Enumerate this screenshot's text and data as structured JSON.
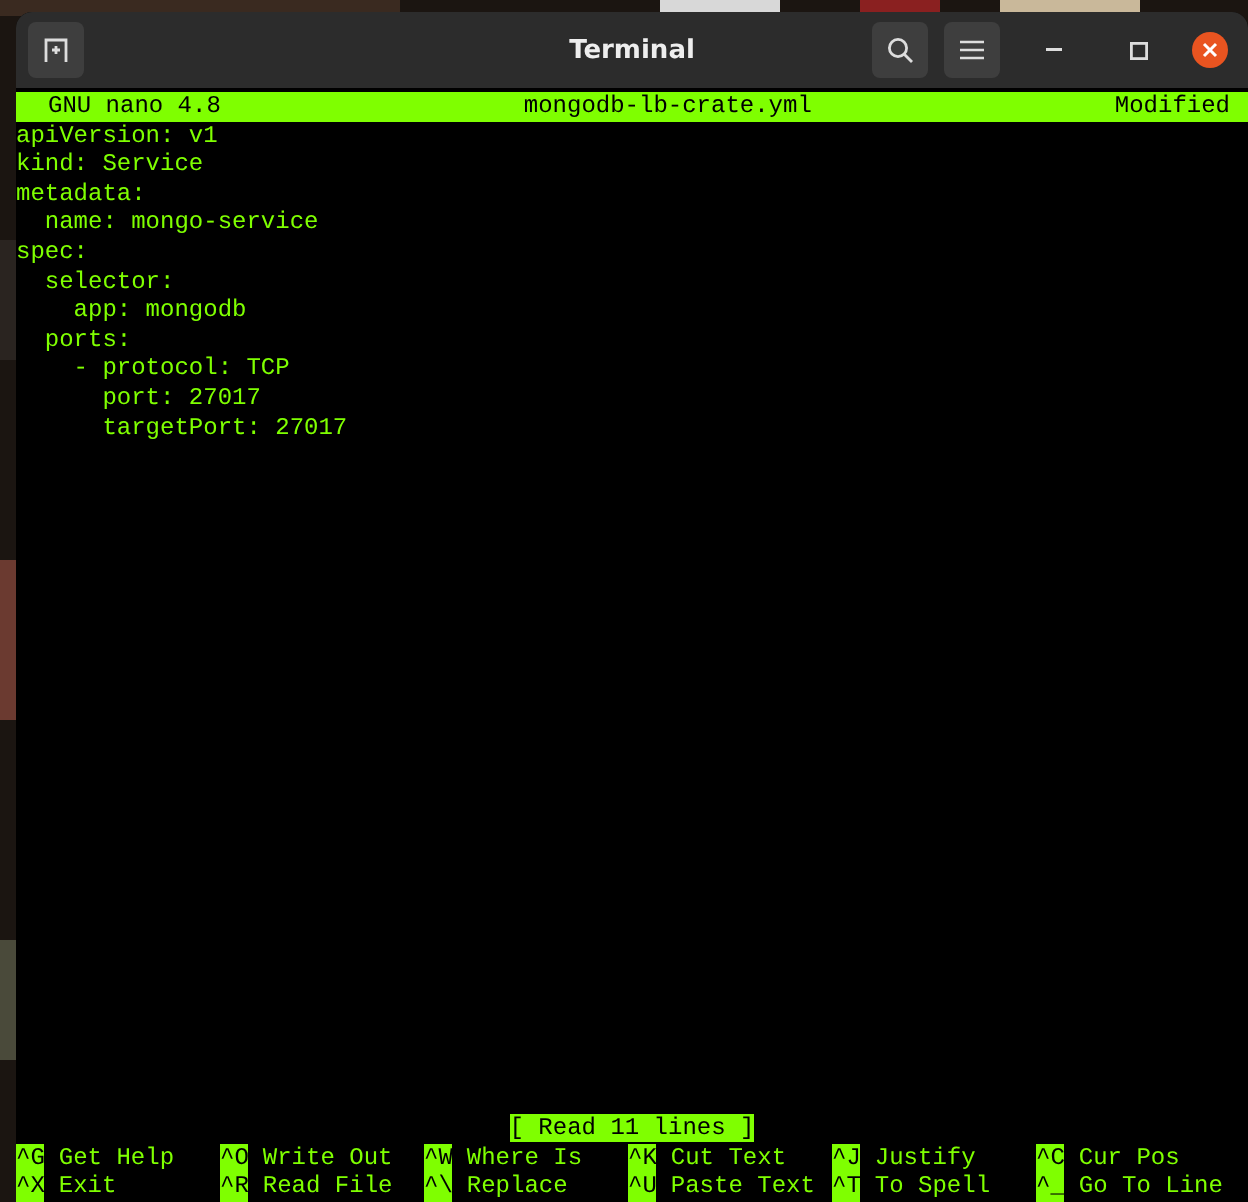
{
  "window": {
    "title": "Terminal"
  },
  "nano": {
    "header": {
      "version": "GNU nano 4.8",
      "filename": "mongodb-lb-crate.yml",
      "state": "Modified"
    },
    "lines": [
      "apiVersion: v1",
      "kind: Service",
      "metadata:",
      "  name: mongo-service",
      "spec:",
      "  selector:",
      "    app: mongodb",
      "  ports:",
      "    - protocol: TCP",
      "      port: 27017",
      "      targetPort: 27017"
    ],
    "status": "[ Read 11 lines ]",
    "shortcuts": [
      [
        {
          "key": "^G",
          "label": "Get Help"
        },
        {
          "key": "^O",
          "label": "Write Out"
        },
        {
          "key": "^W",
          "label": "Where Is"
        },
        {
          "key": "^K",
          "label": "Cut Text"
        },
        {
          "key": "^J",
          "label": "Justify"
        },
        {
          "key": "^C",
          "label": "Cur Pos"
        }
      ],
      [
        {
          "key": "^X",
          "label": "Exit"
        },
        {
          "key": "^R",
          "label": "Read File"
        },
        {
          "key": "^\\",
          "label": "Replace"
        },
        {
          "key": "^U",
          "label": "Paste Text"
        },
        {
          "key": "^T",
          "label": "To Spell"
        },
        {
          "key": "^_",
          "label": "Go To Line"
        }
      ]
    ]
  }
}
